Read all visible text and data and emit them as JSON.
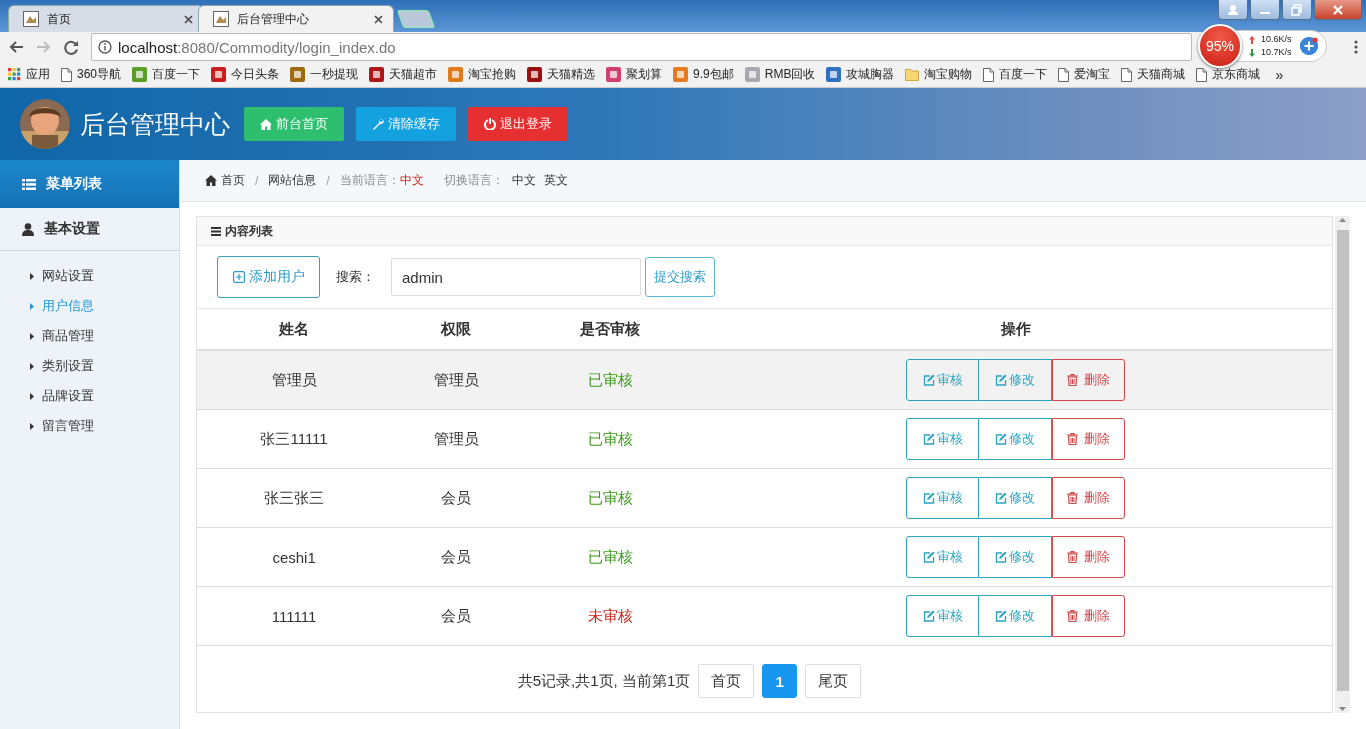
{
  "browser": {
    "tabs": [
      {
        "label": "首页",
        "selected": false
      },
      {
        "label": "后台管理中心",
        "selected": true
      }
    ],
    "url_host": "localhost",
    "url_path": ":8080/Commodity/login_index.do",
    "bookmarks": [
      {
        "label": "应用",
        "kind": "apps"
      },
      {
        "label": "360导航",
        "kind": "page"
      },
      {
        "label": "百度一下",
        "kind": "site"
      },
      {
        "label": "今日头条",
        "kind": "site"
      },
      {
        "label": "一秒提现",
        "kind": "site"
      },
      {
        "label": "天猫超市",
        "kind": "site"
      },
      {
        "label": "淘宝抢购",
        "kind": "site"
      },
      {
        "label": "天猫精选",
        "kind": "site"
      },
      {
        "label": "聚划算",
        "kind": "site"
      },
      {
        "label": "9.9包邮",
        "kind": "site"
      },
      {
        "label": "RMB回收",
        "kind": "site"
      },
      {
        "label": "攻城胸器",
        "kind": "site"
      },
      {
        "label": "淘宝购物",
        "kind": "folder"
      },
      {
        "label": "百度一下",
        "kind": "page"
      },
      {
        "label": "爱淘宝",
        "kind": "page"
      },
      {
        "label": "天猫商城",
        "kind": "page"
      },
      {
        "label": "京东商城",
        "kind": "page"
      }
    ],
    "bookmarks_overflow": "»"
  },
  "monitor": {
    "percent": "95%",
    "upload": "10.6K/s",
    "download": "10.7K/s"
  },
  "header": {
    "title": "后台管理中心",
    "buttons": [
      {
        "label": "前台首页",
        "kind": "home"
      },
      {
        "label": "清除缓存",
        "kind": "wrench"
      },
      {
        "label": "退出登录",
        "kind": "power"
      }
    ]
  },
  "sidebar": {
    "title": "菜单列表",
    "section": "基本设置",
    "items": [
      {
        "label": "网站设置",
        "selected": false
      },
      {
        "label": "用户信息",
        "selected": true
      },
      {
        "label": "商品管理",
        "selected": false
      },
      {
        "label": "类别设置",
        "selected": false
      },
      {
        "label": "品牌设置",
        "selected": false
      },
      {
        "label": "留言管理",
        "selected": false
      }
    ]
  },
  "breadcrumb": {
    "items": [
      "首页",
      "网站信息"
    ],
    "separator": "/",
    "language_label": "当前语言：",
    "language": "中文",
    "switch_label": "切换语言：",
    "switch_options": [
      "中文",
      "英文"
    ]
  },
  "panel": {
    "title": "内容列表",
    "add_button": "添加用户",
    "search_label": "搜索：",
    "search_value": "admin",
    "search_button": "提交搜索"
  },
  "table": {
    "columns": [
      "姓名",
      "权限",
      "是否审核",
      "操作"
    ],
    "rows": [
      {
        "name": "管理员",
        "role": "管理员",
        "status": "已审核",
        "approved": true,
        "selected": true,
        "actions": [
          {
            "label": "审核",
            "kind": "review"
          },
          {
            "label": "修改",
            "kind": "edit"
          },
          {
            "label": "删除",
            "kind": "delete"
          }
        ]
      },
      {
        "name": "张三11111",
        "role": "管理员",
        "status": "已审核",
        "approved": true,
        "selected": false,
        "actions": [
          {
            "label": "审核",
            "kind": "review"
          },
          {
            "label": "修改",
            "kind": "edit"
          },
          {
            "label": "删除",
            "kind": "delete"
          }
        ]
      },
      {
        "name": "张三张三",
        "role": "会员",
        "status": "已审核",
        "approved": true,
        "selected": false,
        "actions": [
          {
            "label": "审核",
            "kind": "review"
          },
          {
            "label": "修改",
            "kind": "edit"
          },
          {
            "label": "删除",
            "kind": "delete"
          }
        ]
      },
      {
        "name": "ceshi1",
        "role": "会员",
        "status": "已审核",
        "approved": true,
        "selected": false,
        "actions": [
          {
            "label": "审核",
            "kind": "review"
          },
          {
            "label": "修改",
            "kind": "edit"
          },
          {
            "label": "删除",
            "kind": "delete"
          }
        ]
      },
      {
        "name": "111111",
        "role": "会员",
        "status": "未审核",
        "approved": false,
        "selected": false,
        "actions": [
          {
            "label": "审核",
            "kind": "review"
          },
          {
            "label": "修改",
            "kind": "edit"
          },
          {
            "label": "删除",
            "kind": "delete"
          }
        ]
      }
    ]
  },
  "pagination": {
    "summary": "共5记录,共1页, 当前第1页",
    "first": "首页",
    "pages": [
      {
        "label": "1",
        "selected": true
      }
    ],
    "last": "尾页"
  }
}
